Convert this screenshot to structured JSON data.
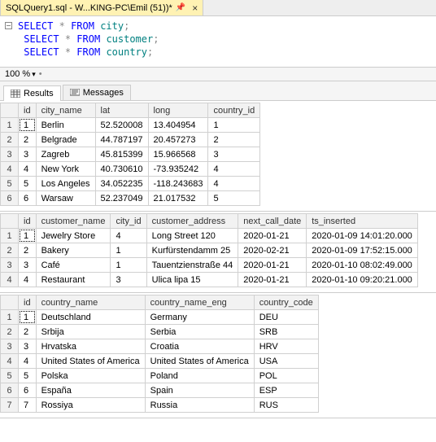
{
  "tab": {
    "title": "SQLQuery1.sql - W...KING-PC\\Emil (51))*"
  },
  "editor": {
    "lines": [
      {
        "kw1": "SELECT",
        "star": "*",
        "kw2": "FROM",
        "ident": "city",
        "semi": ";"
      },
      {
        "kw1": "SELECT",
        "star": "*",
        "kw2": "FROM",
        "ident": "customer",
        "semi": ";"
      },
      {
        "kw1": "SELECT",
        "star": "*",
        "kw2": "FROM",
        "ident": "country",
        "semi": ";"
      }
    ]
  },
  "zoom": {
    "value": "100 %"
  },
  "resultTabs": {
    "results": "Results",
    "messages": "Messages"
  },
  "grid1": {
    "headers": [
      "id",
      "city_name",
      "lat",
      "long",
      "country_id"
    ],
    "rows": [
      [
        "1",
        "Berlin",
        "52.520008",
        "13.404954",
        "1"
      ],
      [
        "2",
        "Belgrade",
        "44.787197",
        "20.457273",
        "2"
      ],
      [
        "3",
        "Zagreb",
        "45.815399",
        "15.966568",
        "3"
      ],
      [
        "4",
        "New York",
        "40.730610",
        "-73.935242",
        "4"
      ],
      [
        "5",
        "Los Angeles",
        "34.052235",
        "-118.243683",
        "4"
      ],
      [
        "6",
        "Warsaw",
        "52.237049",
        "21.017532",
        "5"
      ]
    ]
  },
  "grid2": {
    "headers": [
      "id",
      "customer_name",
      "city_id",
      "customer_address",
      "next_call_date",
      "ts_inserted"
    ],
    "rows": [
      [
        "1",
        "Jewelry Store",
        "4",
        "Long Street 120",
        "2020-01-21",
        "2020-01-09 14:01:20.000"
      ],
      [
        "2",
        "Bakery",
        "1",
        "Kurfürstendamm 25",
        "2020-02-21",
        "2020-01-09 17:52:15.000"
      ],
      [
        "3",
        "Café",
        "1",
        "Tauentzienstraße 44",
        "2020-01-21",
        "2020-01-10 08:02:49.000"
      ],
      [
        "4",
        "Restaurant",
        "3",
        "Ulica lipa 15",
        "2020-01-21",
        "2020-01-10 09:20:21.000"
      ]
    ]
  },
  "grid3": {
    "headers": [
      "id",
      "country_name",
      "country_name_eng",
      "country_code"
    ],
    "rows": [
      [
        "1",
        "Deutschland",
        "Germany",
        "DEU"
      ],
      [
        "2",
        "Srbija",
        "Serbia",
        "SRB"
      ],
      [
        "3",
        "Hrvatska",
        "Croatia",
        "HRV"
      ],
      [
        "4",
        "United States of America",
        "United States of America",
        "USA"
      ],
      [
        "5",
        "Polska",
        "Poland",
        "POL"
      ],
      [
        "6",
        "España",
        "Spain",
        "ESP"
      ],
      [
        "7",
        "Rossiya",
        "Russia",
        "RUS"
      ]
    ]
  }
}
